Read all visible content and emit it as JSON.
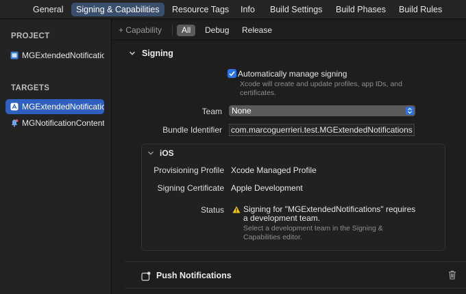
{
  "tabs": [
    {
      "label": "General",
      "active": false
    },
    {
      "label": "Signing & Capabilities",
      "active": true
    },
    {
      "label": "Resource Tags",
      "active": false
    },
    {
      "label": "Info",
      "active": false
    },
    {
      "label": "Build Settings",
      "active": false
    },
    {
      "label": "Build Phases",
      "active": false
    },
    {
      "label": "Build Rules",
      "active": false
    }
  ],
  "sidebar": {
    "project_header": "PROJECT",
    "project_item": "MGExtendedNotifications",
    "targets_header": "TARGETS",
    "targets": [
      {
        "label": "MGExtendedNotifications",
        "selected": true
      },
      {
        "label": "MGNotificationContent",
        "selected": false
      }
    ]
  },
  "filterbar": {
    "capability_label": "+ Capability",
    "filters": [
      {
        "label": "All",
        "active": true
      },
      {
        "label": "Debug",
        "active": false
      },
      {
        "label": "Release",
        "active": false
      }
    ]
  },
  "signing": {
    "title": "Signing",
    "auto_manage_label": "Automatically manage signing",
    "auto_manage_checked": true,
    "auto_manage_hint_line1": "Xcode will create and update profiles, app IDs, and",
    "auto_manage_hint_line2": "certificates.",
    "team_label": "Team",
    "team_value": "None",
    "bundle_label": "Bundle Identifier",
    "bundle_value": "com.marcoguerrieri.test.MGExtendedNotifications"
  },
  "ios": {
    "title": "iOS",
    "profile_label": "Provisioning Profile",
    "profile_value": "Xcode Managed Profile",
    "cert_label": "Signing Certificate",
    "cert_value": "Apple Development",
    "status_label": "Status",
    "status_line1": "Signing for \"MGExtendedNotifications\" requires",
    "status_line2": "a development team.",
    "status_hint_line1": "Select a development team in the Signing &",
    "status_hint_line2": "Capabilities editor."
  },
  "push": {
    "title": "Push Notifications"
  },
  "colors": {
    "accent": "#2a72e6",
    "selected_row": "#2f5fbf",
    "warning": "#f5c518"
  }
}
